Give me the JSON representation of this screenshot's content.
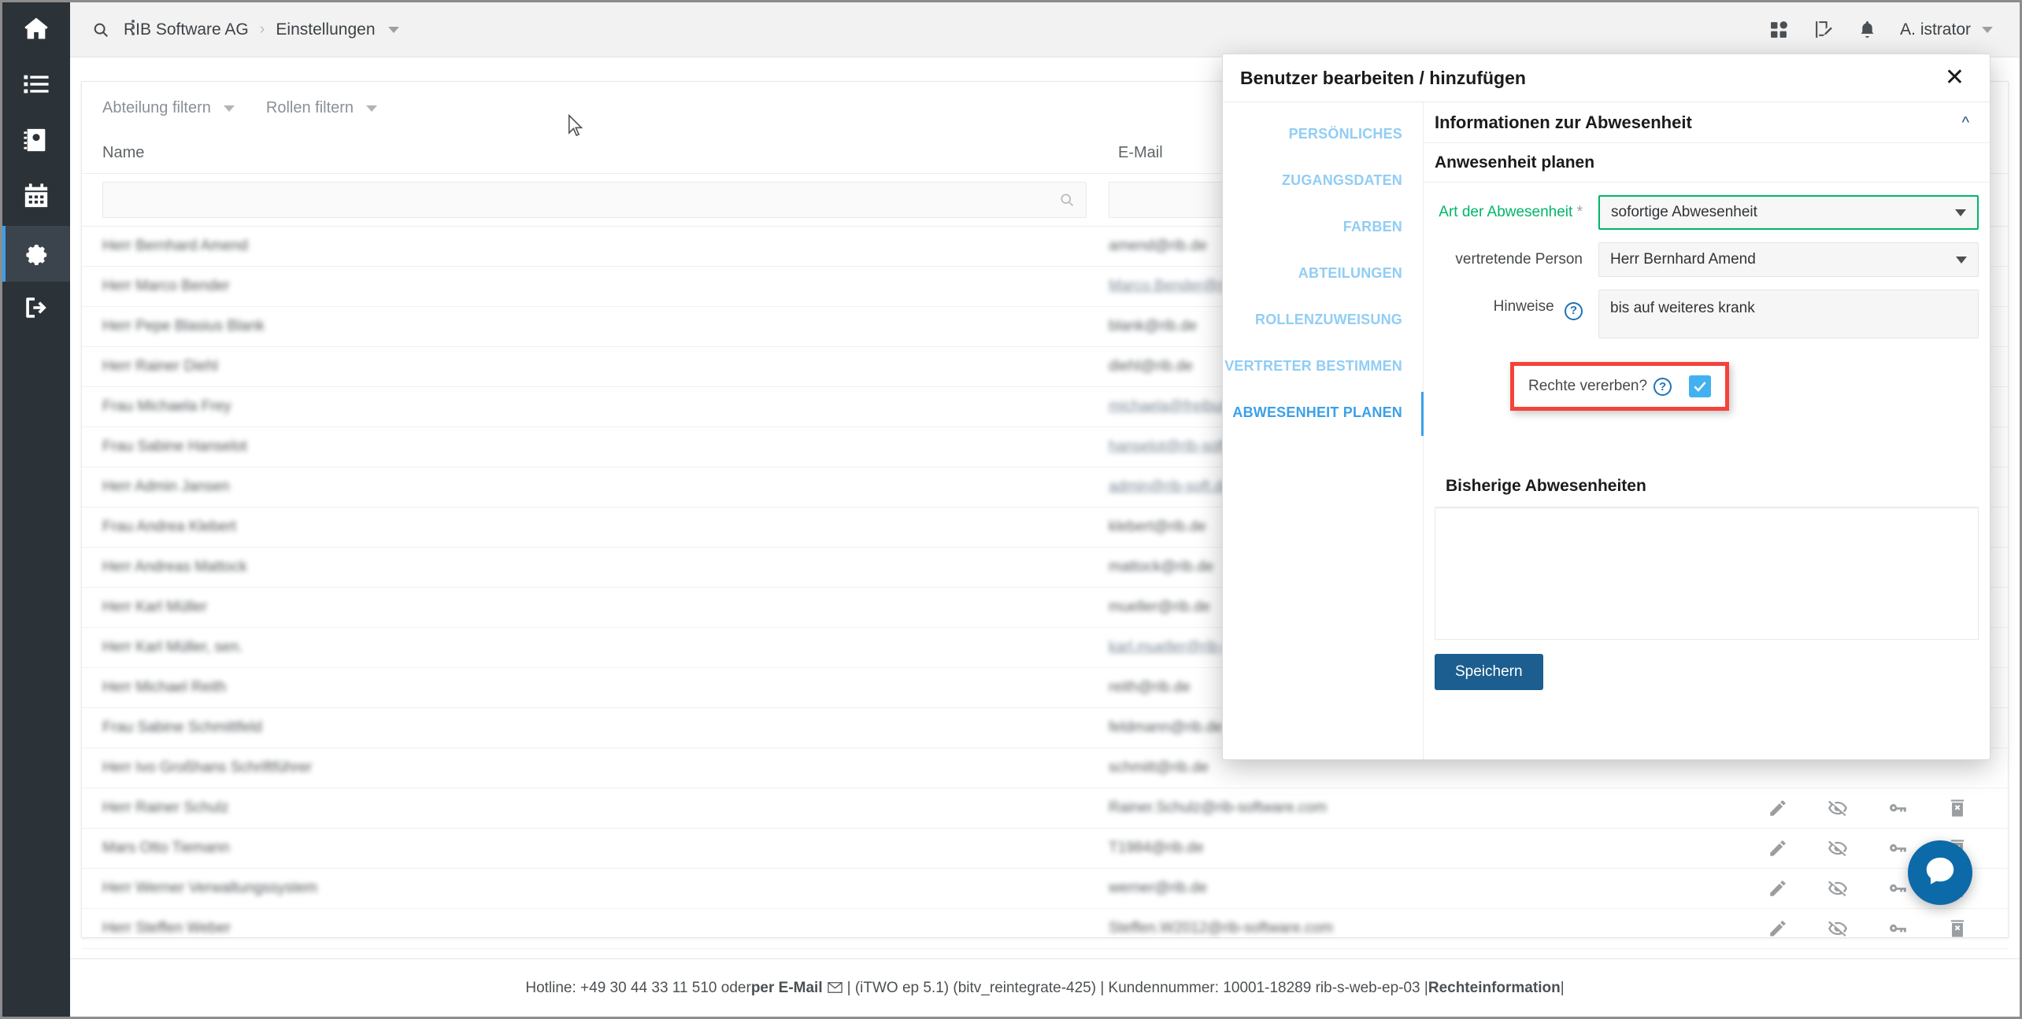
{
  "sidebar": {
    "items": [
      {
        "icon": "home-icon",
        "name": "sidebar-item-home",
        "active": false
      },
      {
        "icon": "list-icon",
        "name": "sidebar-item-list",
        "active": false
      },
      {
        "icon": "contacts-icon",
        "name": "sidebar-item-contacts",
        "active": false
      },
      {
        "icon": "calendar-icon",
        "name": "sidebar-item-calendar",
        "active": false
      },
      {
        "icon": "gear-icon",
        "name": "sidebar-item-settings",
        "active": true
      },
      {
        "icon": "logout-icon",
        "name": "sidebar-item-logout",
        "active": false
      }
    ]
  },
  "topbar": {
    "search_icon": "search-icon",
    "breadcrumb": {
      "root": "RIB Software AG",
      "separator": "›",
      "current": "Einstellungen"
    },
    "icons": [
      "apps-icon",
      "edit-document-icon",
      "bell-icon"
    ],
    "user": "A. istrator"
  },
  "toolbar": {
    "filters": [
      {
        "label": "Abteilung filtern"
      },
      {
        "label": "Rollen filtern"
      }
    ]
  },
  "table": {
    "headers": {
      "name": "Name",
      "email": "E-Mail",
      "actions": ""
    },
    "search": {
      "name_value": "",
      "name_placeholder": "",
      "email_value": "",
      "email_placeholder": ""
    },
    "row_actions": [
      {
        "icon": "pencil-icon",
        "name": "edit-user-button"
      },
      {
        "icon": "eye-off-icon",
        "name": "hide-user-button"
      },
      {
        "icon": "key-icon",
        "name": "reset-password-button"
      },
      {
        "icon": "trash-delete-icon",
        "name": "delete-user-button"
      }
    ],
    "rows": [
      {
        "name": "Herr Bernhard Amend",
        "email": "amend@rib.de",
        "email_link": false,
        "actions": false
      },
      {
        "name": "Herr Marco Bender",
        "email": "Marco.Bender@rib-software.de",
        "email_link": true,
        "actions": false
      },
      {
        "name": "Herr Pepe Blasius Blank",
        "email": "blank@rib.de",
        "email_link": false,
        "actions": false
      },
      {
        "name": "Herr Rainer Diehl",
        "email": "diehl@rib.de",
        "email_link": false,
        "actions": false
      },
      {
        "name": "Frau Michaela Frey",
        "email": "michaela@freiburg.de",
        "email_link": true,
        "actions": false
      },
      {
        "name": "Frau Sabine Hanselot",
        "email": "hanselot@rib-software.de",
        "email_link": true,
        "actions": false
      },
      {
        "name": "Herr Admin Jansen",
        "email": "admin@rib-soft.de",
        "email_link": true,
        "actions": false
      },
      {
        "name": "Frau Andrea Klebert",
        "email": "klebert@rib.de",
        "email_link": false,
        "actions": false
      },
      {
        "name": "Herr Andreas Mattock",
        "email": "mattock@rib.de",
        "email_link": false,
        "actions": false
      },
      {
        "name": "Herr Karl Müller",
        "email": "mueller@rib.de",
        "email_link": false,
        "actions": false
      },
      {
        "name": "Herr Karl Müller, sen.",
        "email": "karl.mueller@rib-soft.de",
        "email_link": true,
        "actions": false
      },
      {
        "name": "Herr Michael Reith",
        "email": "reith@rib.de",
        "email_link": false,
        "actions": false
      },
      {
        "name": "Frau Sabine Schmittfeld",
        "email": "feldmann@rib.de",
        "email_link": false,
        "actions": false
      },
      {
        "name": "Herr Ivo Großhans Schriftführer",
        "email": "schmitt@rib.de",
        "email_link": false,
        "actions": false
      },
      {
        "name": "Herr Rainer Schulz",
        "email": "Rainer.Schulz@rib-software.com",
        "email_link": false,
        "actions": true
      },
      {
        "name": "Mars Otto Tiemann",
        "email": "T1984@rib.de",
        "email_link": false,
        "actions": true
      },
      {
        "name": "Herr Werner Verwaltungssystem",
        "email": "werner@rib.de",
        "email_link": false,
        "actions": true
      },
      {
        "name": "Herr Steffen Weber",
        "email": "Steffen.W2012@rib-software.com",
        "email_link": false,
        "actions": true
      }
    ]
  },
  "footer": {
    "hotline_prefix": "Hotline: +49 30 44 33 11 510 oder ",
    "email_link": "per E-Mail",
    "mail_icon": "envelope-icon",
    "middle": " |  (iTWO ep 5.1) (bitv_reintegrate-425)  |  Kundennummer: 10001-18289 rib-s-web-ep-03 | ",
    "legal_link": "Rechteinformation",
    "suffix": " |"
  },
  "chat_fab": {
    "icon": "chat-bubble-icon",
    "name": "chat-widget-button"
  },
  "modal": {
    "title": "Benutzer bearbeiten / hinzufügen",
    "close_icon": "close-icon",
    "tabs": [
      {
        "label": "PERSÖNLICHES",
        "active": false,
        "name": "tab-persoenliches"
      },
      {
        "label": "ZUGANGSDATEN",
        "active": false,
        "name": "tab-zugangsdaten"
      },
      {
        "label": "FARBEN",
        "active": false,
        "name": "tab-farben"
      },
      {
        "label": "ABTEILUNGEN",
        "active": false,
        "name": "tab-abteilungen"
      },
      {
        "label": "ROLLENZUWEISUNG",
        "active": false,
        "name": "tab-rollenzuweisung"
      },
      {
        "label": "VERTRETER BESTIMMEN",
        "active": false,
        "name": "tab-vertreter-bestimmen"
      },
      {
        "label": "ABWESENHEIT PLANEN",
        "active": true,
        "name": "tab-abwesenheit-planen"
      }
    ],
    "panel": {
      "heading": "Informationen zur Abwesenheit",
      "collapse_icon": "chevron-up-icon",
      "section_title": "Anwesenheit planen",
      "fields": {
        "absence_type": {
          "label": "Art der Abwesenheit",
          "required_mark": "*",
          "value": "sofortige Abwesenheit"
        },
        "deputy": {
          "label": "vertretende Person",
          "value": "Herr Bernhard Amend"
        },
        "notes": {
          "label": "Hinweise",
          "help_icon": "help-icon",
          "value": "bis auf weiteres krank"
        },
        "inherit": {
          "label": "Rechte vererben?",
          "help_icon": "help-icon",
          "checked": true
        }
      },
      "history_title": "Bisherige Abwesenheiten",
      "save_label": "Speichern"
    }
  },
  "colors": {
    "rail_bg": "#2b3238",
    "accent_blue": "#3ba0e8",
    "tab_inactive": "#91cdf4",
    "valid_green": "#00b569",
    "highlight_red": "#f4443a",
    "checkbox_blue": "#42b1ef",
    "save_button": "#1b5e8f",
    "fab_blue": "#0d6aa8"
  }
}
